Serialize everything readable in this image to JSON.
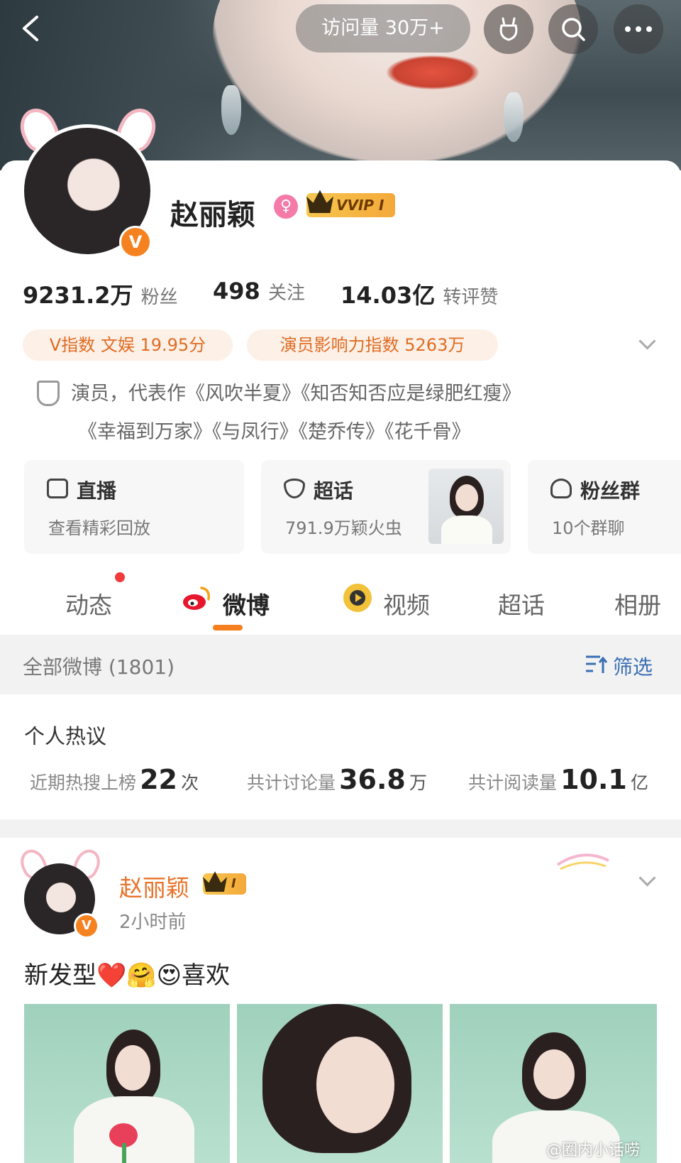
{
  "header": {
    "visits": "访问量 30万+",
    "icons": [
      "back-icon",
      "gift-icon",
      "search-icon",
      "more-icon"
    ]
  },
  "profile": {
    "name": "赵丽颖",
    "vvip_label": "VVIP I",
    "gender_symbol": "♀",
    "verified_badge": "V",
    "stats": [
      {
        "value": "9231.2万",
        "unit": "粉丝"
      },
      {
        "value": "498",
        "unit": "关注"
      },
      {
        "value": "14.03亿",
        "unit": "转评赞"
      }
    ],
    "index_pills": [
      "V指数 文娱 19.95分",
      "演员影响力指数 5263万"
    ],
    "bio_line1": "演员，代表作《风吹半夏》《知否知否应是绿肥红瘦》",
    "bio_line2": "《幸福到万家》《与凤行》《楚乔传》《花千骨》"
  },
  "tiles": [
    {
      "title": "直播",
      "sub": "查看精彩回放"
    },
    {
      "title": "超话",
      "sub": "791.9万颖火虫"
    },
    {
      "title": "粉丝群",
      "sub": "10个群聊"
    }
  ],
  "tabs": [
    "动态",
    "微博",
    "视频",
    "超话",
    "相册"
  ],
  "active_tab": "微博",
  "filter_bar": {
    "label": "全部微博 (1801)",
    "filter": "筛选"
  },
  "hot": {
    "title": "个人热议",
    "items": [
      {
        "label": "近期热搜上榜",
        "value": "22",
        "unit": "次"
      },
      {
        "label": "共计讨论量",
        "value": "36.8",
        "unit": "万"
      },
      {
        "label": "共计阅读量",
        "value": "10.1",
        "unit": "亿"
      }
    ]
  },
  "post": {
    "author": "赵丽颖",
    "member_label": "I",
    "time": "2小时前",
    "text": "新发型",
    "emoji": "❤️🤗😍",
    "text_tail": "喜欢"
  },
  "watermark": "@圈内小话唠",
  "colors": {
    "accent": "#f57e1e",
    "pill_text": "#e06c22",
    "name_orange": "#e8732a",
    "link_blue": "#3a6fb5"
  }
}
